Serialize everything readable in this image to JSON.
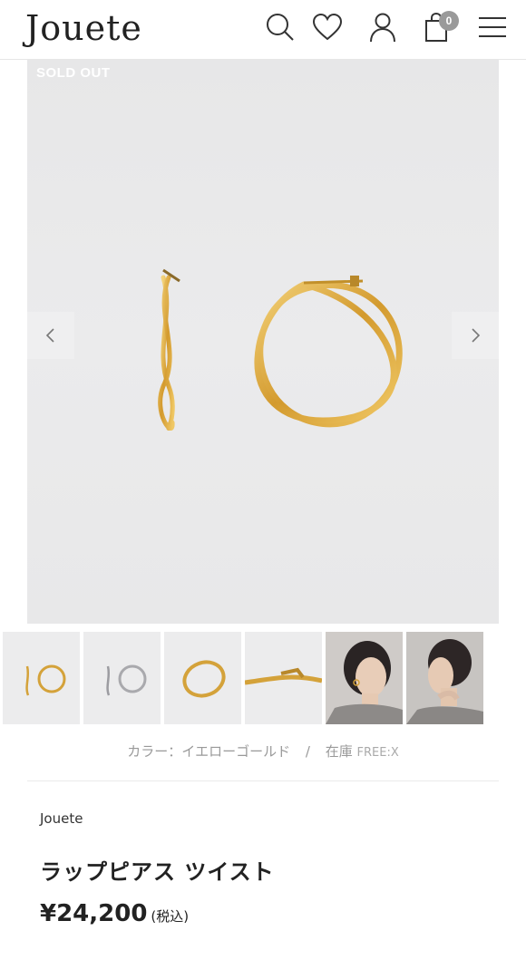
{
  "header": {
    "logo": "Jouete",
    "cart_count": "0",
    "icons": [
      "search-icon",
      "heart-icon",
      "user-icon",
      "bag-icon",
      "menu-icon"
    ]
  },
  "hero": {
    "badge": "SOLD OUT",
    "prev_icon": "chevron-left-icon",
    "next_icon": "chevron-right-icon"
  },
  "thumbnails": [
    {
      "name": "thumb-gold-pair"
    },
    {
      "name": "thumb-silver-pair"
    },
    {
      "name": "thumb-gold-hoop"
    },
    {
      "name": "thumb-clasp-detail"
    },
    {
      "name": "thumb-model-side"
    },
    {
      "name": "thumb-model-profile"
    }
  ],
  "meta": {
    "color_label": "カラー：イエローゴールド",
    "separator": "/",
    "stock_label": "在庫",
    "size_stock": "FREE:X"
  },
  "product": {
    "brand": "Jouete",
    "title": "ラップピアス ツイスト",
    "price": "¥24,200",
    "tax_note": "(税込)"
  },
  "colors": {
    "gold": "#d4a23a",
    "gold_light": "#f0d27a",
    "silver": "#a9a9ad",
    "badge_gray": "#9a9a9a"
  }
}
